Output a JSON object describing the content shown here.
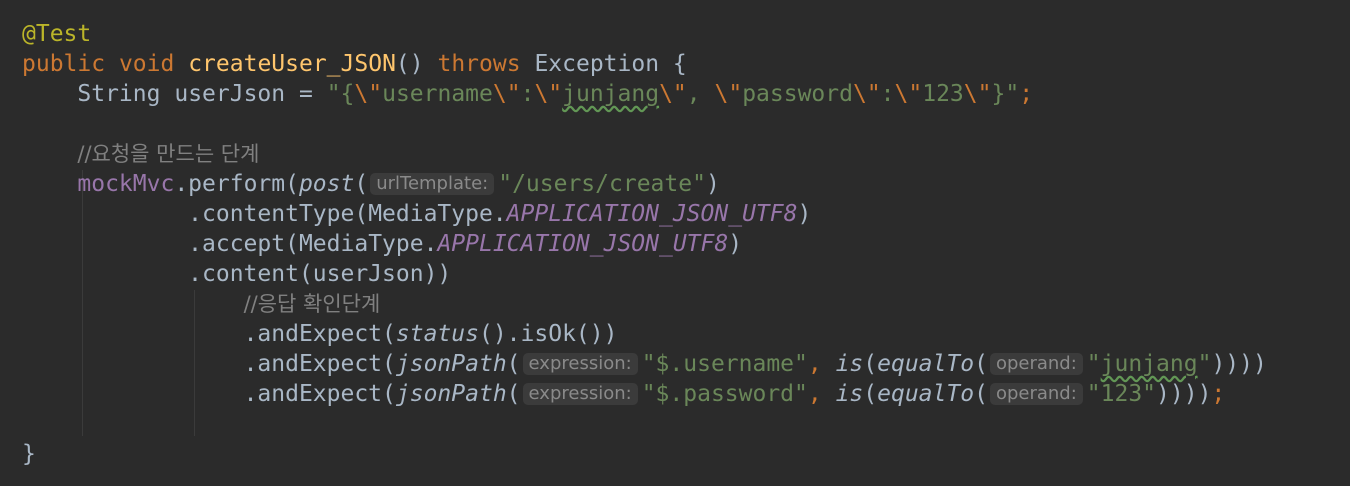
{
  "colors": {
    "background": "#2b2b2b",
    "annotation": "#bbb529",
    "keyword": "#cc7832",
    "method_declaration": "#ffc66d",
    "plain": "#a9b7c6",
    "string": "#6a8759",
    "field": "#9876aa",
    "comment": "#808080",
    "inlay_hint_bg": "#3b3b3b",
    "inlay_hint_text": "#8a8a8a"
  },
  "code": {
    "annotation": "@Test",
    "kw_public": "public",
    "kw_void": "void",
    "method_name": "createUser_JSON",
    "paren_open_close": "()",
    "kw_throws": "throws",
    "exception_type": "Exception",
    "brace_open": "{",
    "string_type": "String",
    "var_userjson_decl": "userJson =",
    "str_quote_brace": "\"{",
    "esc_quote": "\\\"",
    "str_username": "username",
    "str_colon": ":",
    "str_junjang": "junjang",
    "str_comma_space": ", ",
    "str_password": "password",
    "str_123": "123",
    "str_brace_quote": "}\"",
    "semicolon": ";",
    "comment_request": "//요청을 만드는 단계",
    "mockmvc_field": "mockMvc",
    "perform_call": ".perform(",
    "post_call": "post",
    "paren_open": "(",
    "hint_url_template": "urlTemplate:",
    "str_users_create": "\"/users/create\"",
    "paren_close": ")",
    "content_type_call": ".contentType(",
    "mediatype_class": "MediaType.",
    "const_app_json": "APPLICATION_JSON_UTF8",
    "accept_call": ".accept(",
    "content_call": ".content(userJson))",
    "comment_response": "//응답 확인단계",
    "and_expect_call": ".andExpect(",
    "status_call": "status",
    "is_ok_rest": "().isOk())",
    "json_path_call": "jsonPath",
    "hint_expression": "expression:",
    "str_username_path": "\"$.username\"",
    "comma": ", ",
    "is_call": "is",
    "equal_to_call": "equalTo",
    "hint_operand": "operand:",
    "str_junjang_open": "\"",
    "str_junjang_word": "junjang",
    "str_junjang_close": "\"",
    "close_four": "))))",
    "str_password_path": "\"$.password\"",
    "str_123_literal": "\"123\"",
    "brace_close": "}"
  }
}
